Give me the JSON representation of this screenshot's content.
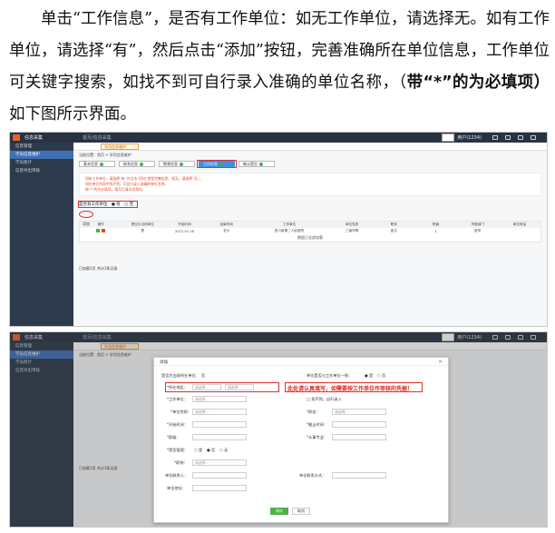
{
  "paragraph": {
    "part1": "单击“工作信息”，是否有工作单位：如无工作单位，请选择无。如有工作单位，请选择“有”，然后点击“添加”按钮，完善准确所在单位信息，工作单位可关键字搜索，如找不到可自行录入准确的单位名称，（",
    "bold": "带“*”的为必填项）",
    "part2": "如下图所示界面。"
  },
  "screenshot1": {
    "app_name": "信息采集",
    "crumb": "首页/信息采集",
    "role": "用户(1234)",
    "sidebar": [
      "信息管理",
      "学员信息维护",
      "学员统计",
      "信息导出审核"
    ],
    "active_sidebar_index": 1,
    "page_tab": "学员信息维护",
    "breadcrumb": "当前位置：首页 > 学员信息维护",
    "steps": [
      "基本信息",
      "联系信息",
      "教育信息",
      "工作信息",
      "确认提交"
    ],
    "active_step_index": 3,
    "notices": [
      "如有工作单位，请选择“有”并点击“添加”按钮完善信息；如无，请选择“无”。",
      "如在单位列表中找不到，可自行录入准确的单位名称。",
      "带“*”的为必填项，填写后请点击保存。"
    ],
    "question": "是否有工作单位",
    "options": [
      "有",
      "无"
    ],
    "add_button": "添加",
    "columns": [
      "操作",
      "是否为当前单位",
      "开始时间",
      "结束时间",
      "工作单位",
      "单位性质",
      "职务",
      "职级",
      "所属部门",
      "单位电话"
    ],
    "row": [
      "",
      "是",
      "2021-01-18",
      "至今",
      "四川省第二人民医院",
      "三级甲等",
      "医生",
      "1",
      "医务",
      ""
    ],
    "no_more": "数据已全部加载",
    "footer": "已加载1页  共计1条记录"
  },
  "screenshot2": {
    "app_name": "信息采集",
    "crumb": "首页/信息采集",
    "role": "用户(1234)",
    "sidebar": [
      "信息管理",
      "学员信息维护",
      "学员统计",
      "信息导出审核"
    ],
    "active_sidebar_index": 1,
    "page_tab": "学员信息维护",
    "breadcrumb": "当前位置：首页 > 学员信息维护",
    "footer": "已加载1页  共计1条记录",
    "modal": {
      "title": "添加",
      "close": "×",
      "label_current_unit": "是否为当前所在单位：",
      "current_unit_value": "否",
      "label_same": "单位是否与工作单位一致：",
      "same_options": [
        "是",
        "否"
      ],
      "label_unit_region": "*所在地区：",
      "label_unit_name": "*工作单位：",
      "not_found_label": "找不到，自行录入",
      "label_dept": "*单位性质：",
      "label_duty": "*职务：",
      "label_start": "*开始时间：",
      "label_end": "*截止时间：",
      "label_level": "*职级：",
      "label_major": "*从事专业：",
      "label_is_mgr": "*是否管理：",
      "is_mgr_options": [
        "是",
        "否",
        "无"
      ],
      "label_title": "*职称：",
      "label_contact": "单位联系人：",
      "label_phone": "单位联系方式：",
      "label_remark": "单位地址：",
      "placeholder": "请选择...",
      "warning": "此处请认真填写，如需要按工作单位作审核的凭据！",
      "save": "保存",
      "cancel": "取消"
    }
  }
}
